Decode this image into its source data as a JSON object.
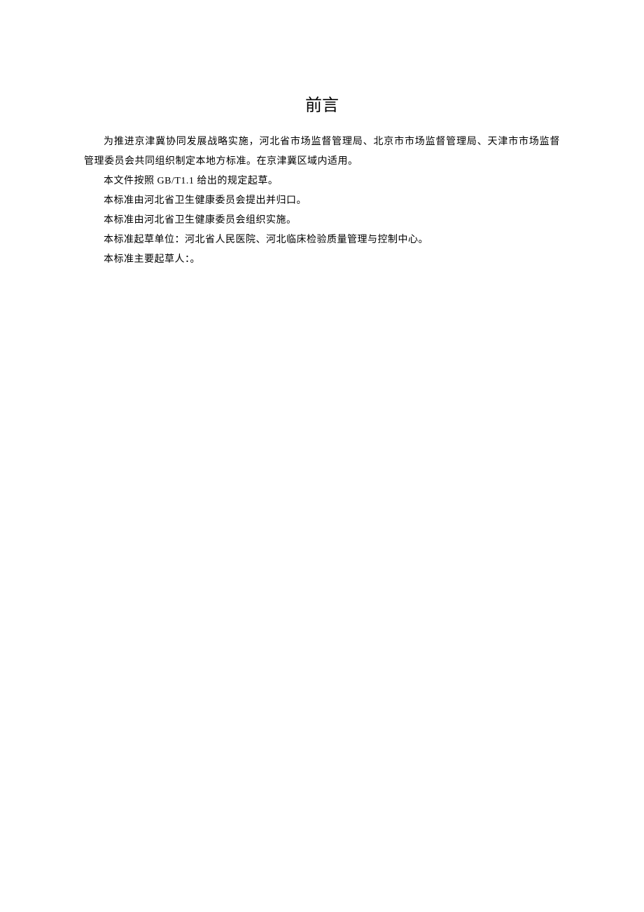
{
  "title": "前言",
  "paragraphs": [
    "为推进京津冀协同发展战略实施，河北省市场监督管理局、北京市市场监督管理局、天津市市场监督管理委员会共同组织制定本地方标准。在京津冀区域内适用。",
    "本文件按照 GB/T1.1 给出的规定起草。",
    "本标准由河北省卫生健康委员会提出并归口。",
    "本标准由河北省卫生健康委员会组织实施。",
    "本标准起草单位：河北省人民医院、河北临床检验质量管理与控制中心。",
    "本标准主要起草人：。"
  ]
}
